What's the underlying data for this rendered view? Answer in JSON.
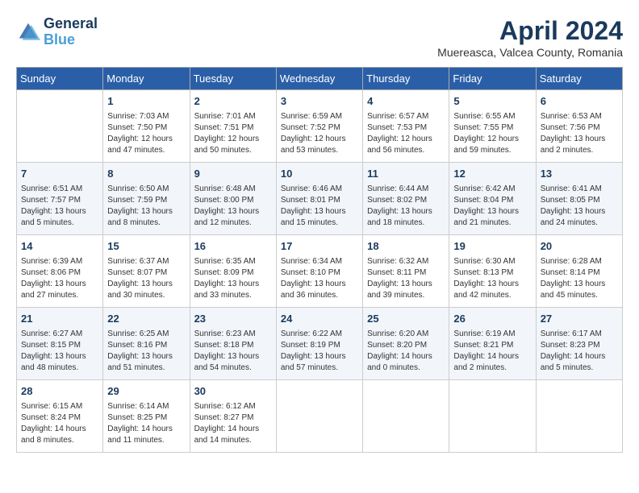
{
  "header": {
    "logo_line1": "General",
    "logo_line2": "Blue",
    "month": "April 2024",
    "location": "Muereasca, Valcea County, Romania"
  },
  "days_of_week": [
    "Sunday",
    "Monday",
    "Tuesday",
    "Wednesday",
    "Thursday",
    "Friday",
    "Saturday"
  ],
  "weeks": [
    [
      {
        "day": "",
        "info": ""
      },
      {
        "day": "1",
        "info": "Sunrise: 7:03 AM\nSunset: 7:50 PM\nDaylight: 12 hours\nand 47 minutes."
      },
      {
        "day": "2",
        "info": "Sunrise: 7:01 AM\nSunset: 7:51 PM\nDaylight: 12 hours\nand 50 minutes."
      },
      {
        "day": "3",
        "info": "Sunrise: 6:59 AM\nSunset: 7:52 PM\nDaylight: 12 hours\nand 53 minutes."
      },
      {
        "day": "4",
        "info": "Sunrise: 6:57 AM\nSunset: 7:53 PM\nDaylight: 12 hours\nand 56 minutes."
      },
      {
        "day": "5",
        "info": "Sunrise: 6:55 AM\nSunset: 7:55 PM\nDaylight: 12 hours\nand 59 minutes."
      },
      {
        "day": "6",
        "info": "Sunrise: 6:53 AM\nSunset: 7:56 PM\nDaylight: 13 hours\nand 2 minutes."
      }
    ],
    [
      {
        "day": "7",
        "info": "Sunrise: 6:51 AM\nSunset: 7:57 PM\nDaylight: 13 hours\nand 5 minutes."
      },
      {
        "day": "8",
        "info": "Sunrise: 6:50 AM\nSunset: 7:59 PM\nDaylight: 13 hours\nand 8 minutes."
      },
      {
        "day": "9",
        "info": "Sunrise: 6:48 AM\nSunset: 8:00 PM\nDaylight: 13 hours\nand 12 minutes."
      },
      {
        "day": "10",
        "info": "Sunrise: 6:46 AM\nSunset: 8:01 PM\nDaylight: 13 hours\nand 15 minutes."
      },
      {
        "day": "11",
        "info": "Sunrise: 6:44 AM\nSunset: 8:02 PM\nDaylight: 13 hours\nand 18 minutes."
      },
      {
        "day": "12",
        "info": "Sunrise: 6:42 AM\nSunset: 8:04 PM\nDaylight: 13 hours\nand 21 minutes."
      },
      {
        "day": "13",
        "info": "Sunrise: 6:41 AM\nSunset: 8:05 PM\nDaylight: 13 hours\nand 24 minutes."
      }
    ],
    [
      {
        "day": "14",
        "info": "Sunrise: 6:39 AM\nSunset: 8:06 PM\nDaylight: 13 hours\nand 27 minutes."
      },
      {
        "day": "15",
        "info": "Sunrise: 6:37 AM\nSunset: 8:07 PM\nDaylight: 13 hours\nand 30 minutes."
      },
      {
        "day": "16",
        "info": "Sunrise: 6:35 AM\nSunset: 8:09 PM\nDaylight: 13 hours\nand 33 minutes."
      },
      {
        "day": "17",
        "info": "Sunrise: 6:34 AM\nSunset: 8:10 PM\nDaylight: 13 hours\nand 36 minutes."
      },
      {
        "day": "18",
        "info": "Sunrise: 6:32 AM\nSunset: 8:11 PM\nDaylight: 13 hours\nand 39 minutes."
      },
      {
        "day": "19",
        "info": "Sunrise: 6:30 AM\nSunset: 8:13 PM\nDaylight: 13 hours\nand 42 minutes."
      },
      {
        "day": "20",
        "info": "Sunrise: 6:28 AM\nSunset: 8:14 PM\nDaylight: 13 hours\nand 45 minutes."
      }
    ],
    [
      {
        "day": "21",
        "info": "Sunrise: 6:27 AM\nSunset: 8:15 PM\nDaylight: 13 hours\nand 48 minutes."
      },
      {
        "day": "22",
        "info": "Sunrise: 6:25 AM\nSunset: 8:16 PM\nDaylight: 13 hours\nand 51 minutes."
      },
      {
        "day": "23",
        "info": "Sunrise: 6:23 AM\nSunset: 8:18 PM\nDaylight: 13 hours\nand 54 minutes."
      },
      {
        "day": "24",
        "info": "Sunrise: 6:22 AM\nSunset: 8:19 PM\nDaylight: 13 hours\nand 57 minutes."
      },
      {
        "day": "25",
        "info": "Sunrise: 6:20 AM\nSunset: 8:20 PM\nDaylight: 14 hours\nand 0 minutes."
      },
      {
        "day": "26",
        "info": "Sunrise: 6:19 AM\nSunset: 8:21 PM\nDaylight: 14 hours\nand 2 minutes."
      },
      {
        "day": "27",
        "info": "Sunrise: 6:17 AM\nSunset: 8:23 PM\nDaylight: 14 hours\nand 5 minutes."
      }
    ],
    [
      {
        "day": "28",
        "info": "Sunrise: 6:15 AM\nSunset: 8:24 PM\nDaylight: 14 hours\nand 8 minutes."
      },
      {
        "day": "29",
        "info": "Sunrise: 6:14 AM\nSunset: 8:25 PM\nDaylight: 14 hours\nand 11 minutes."
      },
      {
        "day": "30",
        "info": "Sunrise: 6:12 AM\nSunset: 8:27 PM\nDaylight: 14 hours\nand 14 minutes."
      },
      {
        "day": "",
        "info": ""
      },
      {
        "day": "",
        "info": ""
      },
      {
        "day": "",
        "info": ""
      },
      {
        "day": "",
        "info": ""
      }
    ]
  ]
}
